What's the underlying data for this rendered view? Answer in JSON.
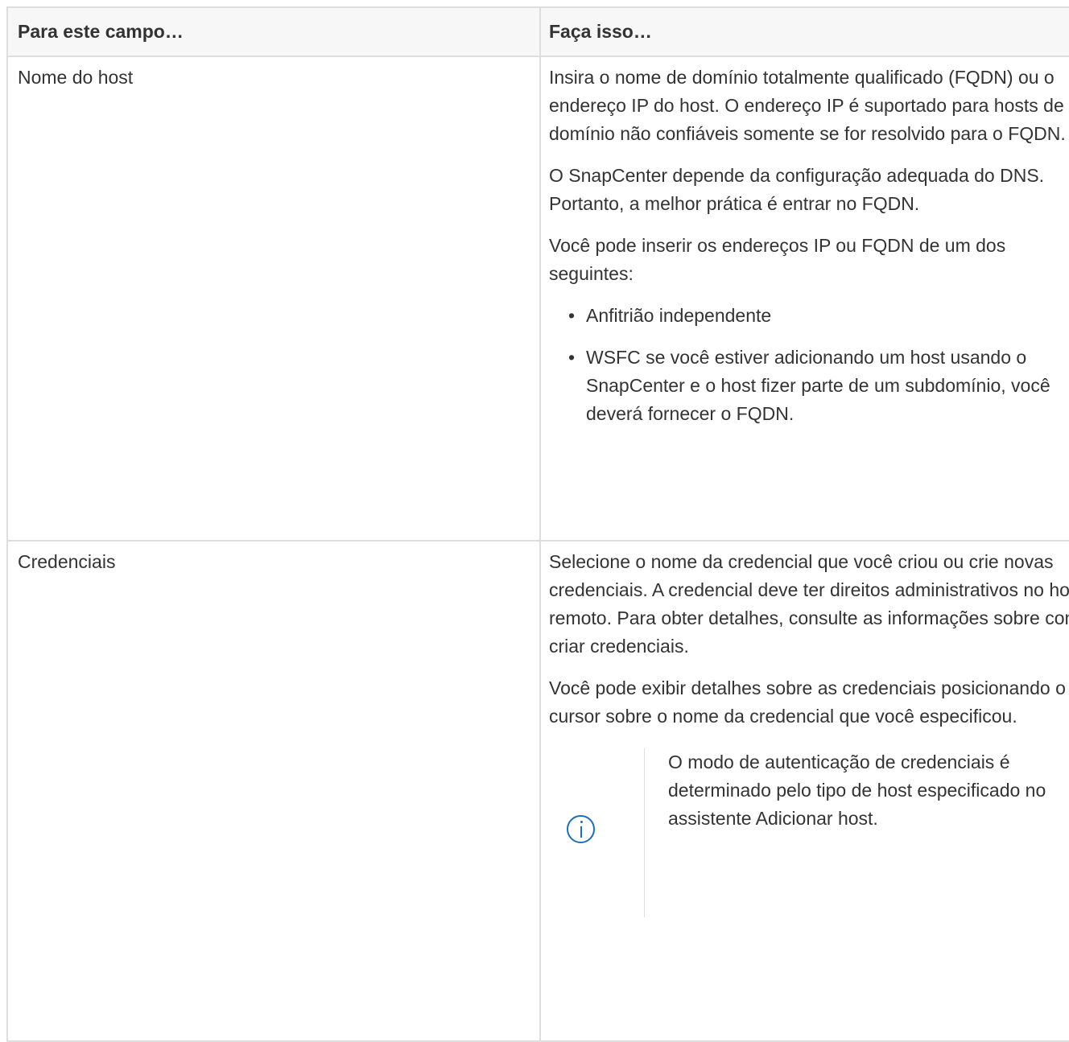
{
  "table": {
    "header": {
      "field": "Para este campo…",
      "action": "Faça isso…"
    },
    "rows": [
      {
        "field": "Nome do host",
        "paragraphs": [
          "Insira o nome de domínio totalmente qualificado (FQDN) ou o endereço IP do host. O endereço IP é suportado para hosts de domínio não confiáveis somente se for resolvido para o FQDN.",
          "O SnapCenter depende da configuração adequada do DNS. Portanto, a melhor prática é entrar no FQDN.",
          "Você pode inserir os endereços IP ou FQDN de um dos seguintes:"
        ],
        "bullets": [
          "Anfitrião independente",
          "WSFC se você estiver adicionando um host usando o SnapCenter e o host fizer parte de um subdomínio, você deverá fornecer o FQDN."
        ]
      },
      {
        "field": "Credenciais",
        "paragraphs": [
          "Selecione o nome da credencial que você criou ou crie novas credenciais. A credencial deve ter direitos administrativos no host remoto. Para obter detalhes, consulte as informações sobre como criar credenciais.",
          "Você pode exibir detalhes sobre as credenciais posicionando o cursor sobre o nome da credencial que você especificou."
        ],
        "note": {
          "icon": "info-icon",
          "text": "O modo de autenticação de credenciais é determinado pelo tipo de host especificado no assistente Adicionar host."
        }
      }
    ]
  },
  "colors": {
    "text": "#333333",
    "border": "#dedede",
    "header_bg": "#f7f7f7",
    "info_icon": "#1d6eb6"
  }
}
